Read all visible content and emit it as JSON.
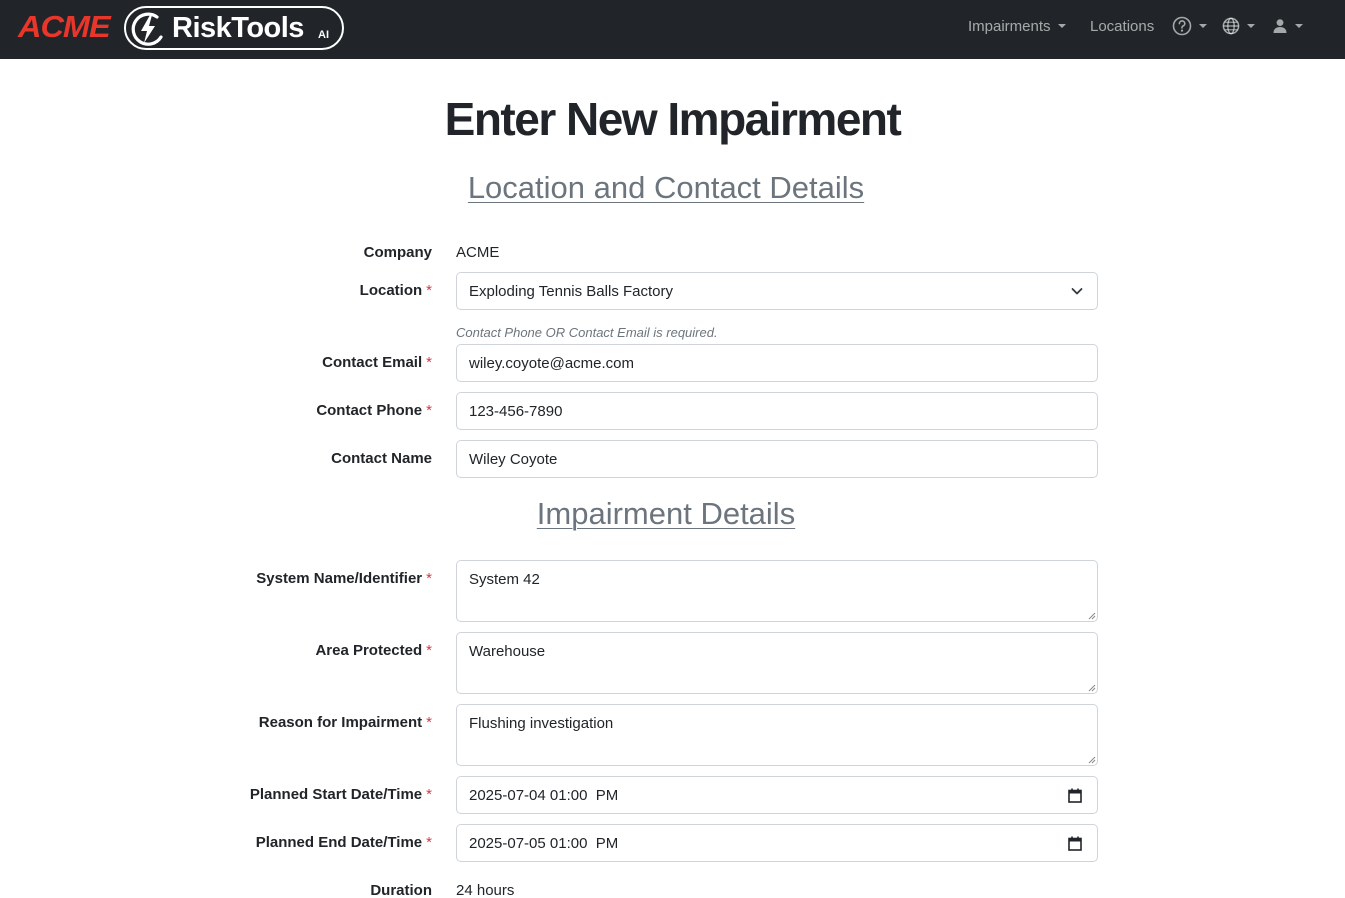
{
  "brand": {
    "acme": "ACME",
    "risktools": "RiskTools",
    "ai": "AI"
  },
  "nav": {
    "impairments": "Impairments",
    "locations": "Locations"
  },
  "page_title": "Enter New Impairment",
  "sections": {
    "location": "Location and Contact Details",
    "impairment": "Impairment Details"
  },
  "form": {
    "company": {
      "label": "Company",
      "value": "ACME"
    },
    "location": {
      "label": "Location",
      "value": "Exploding Tennis Balls Factory"
    },
    "contact_help": "Contact Phone OR Contact Email is required.",
    "contact_email": {
      "label": "Contact Email",
      "value": "wiley.coyote@acme.com"
    },
    "contact_phone": {
      "label": "Contact Phone",
      "value": "123-456-7890"
    },
    "contact_name": {
      "label": "Contact Name",
      "value": "Wiley Coyote"
    },
    "system_name": {
      "label": "System Name/Identifier",
      "value": "System 42"
    },
    "area_protected": {
      "label": "Area Protected",
      "value": "Warehouse"
    },
    "reason": {
      "label": "Reason for Impairment",
      "value": "Flushing investigation"
    },
    "planned_start": {
      "label": "Planned Start Date/Time",
      "value": "2025-07-04 01:00  PM"
    },
    "planned_end": {
      "label": "Planned End Date/Time",
      "value": "2025-07-05 01:00  PM"
    },
    "duration": {
      "label": "Duration",
      "value": "24 hours"
    },
    "required_marker": "*"
  },
  "colors": {
    "navbar": "#212529",
    "acme_red": "#e8362b",
    "required": "#dc3545",
    "muted": "#6c757d"
  }
}
